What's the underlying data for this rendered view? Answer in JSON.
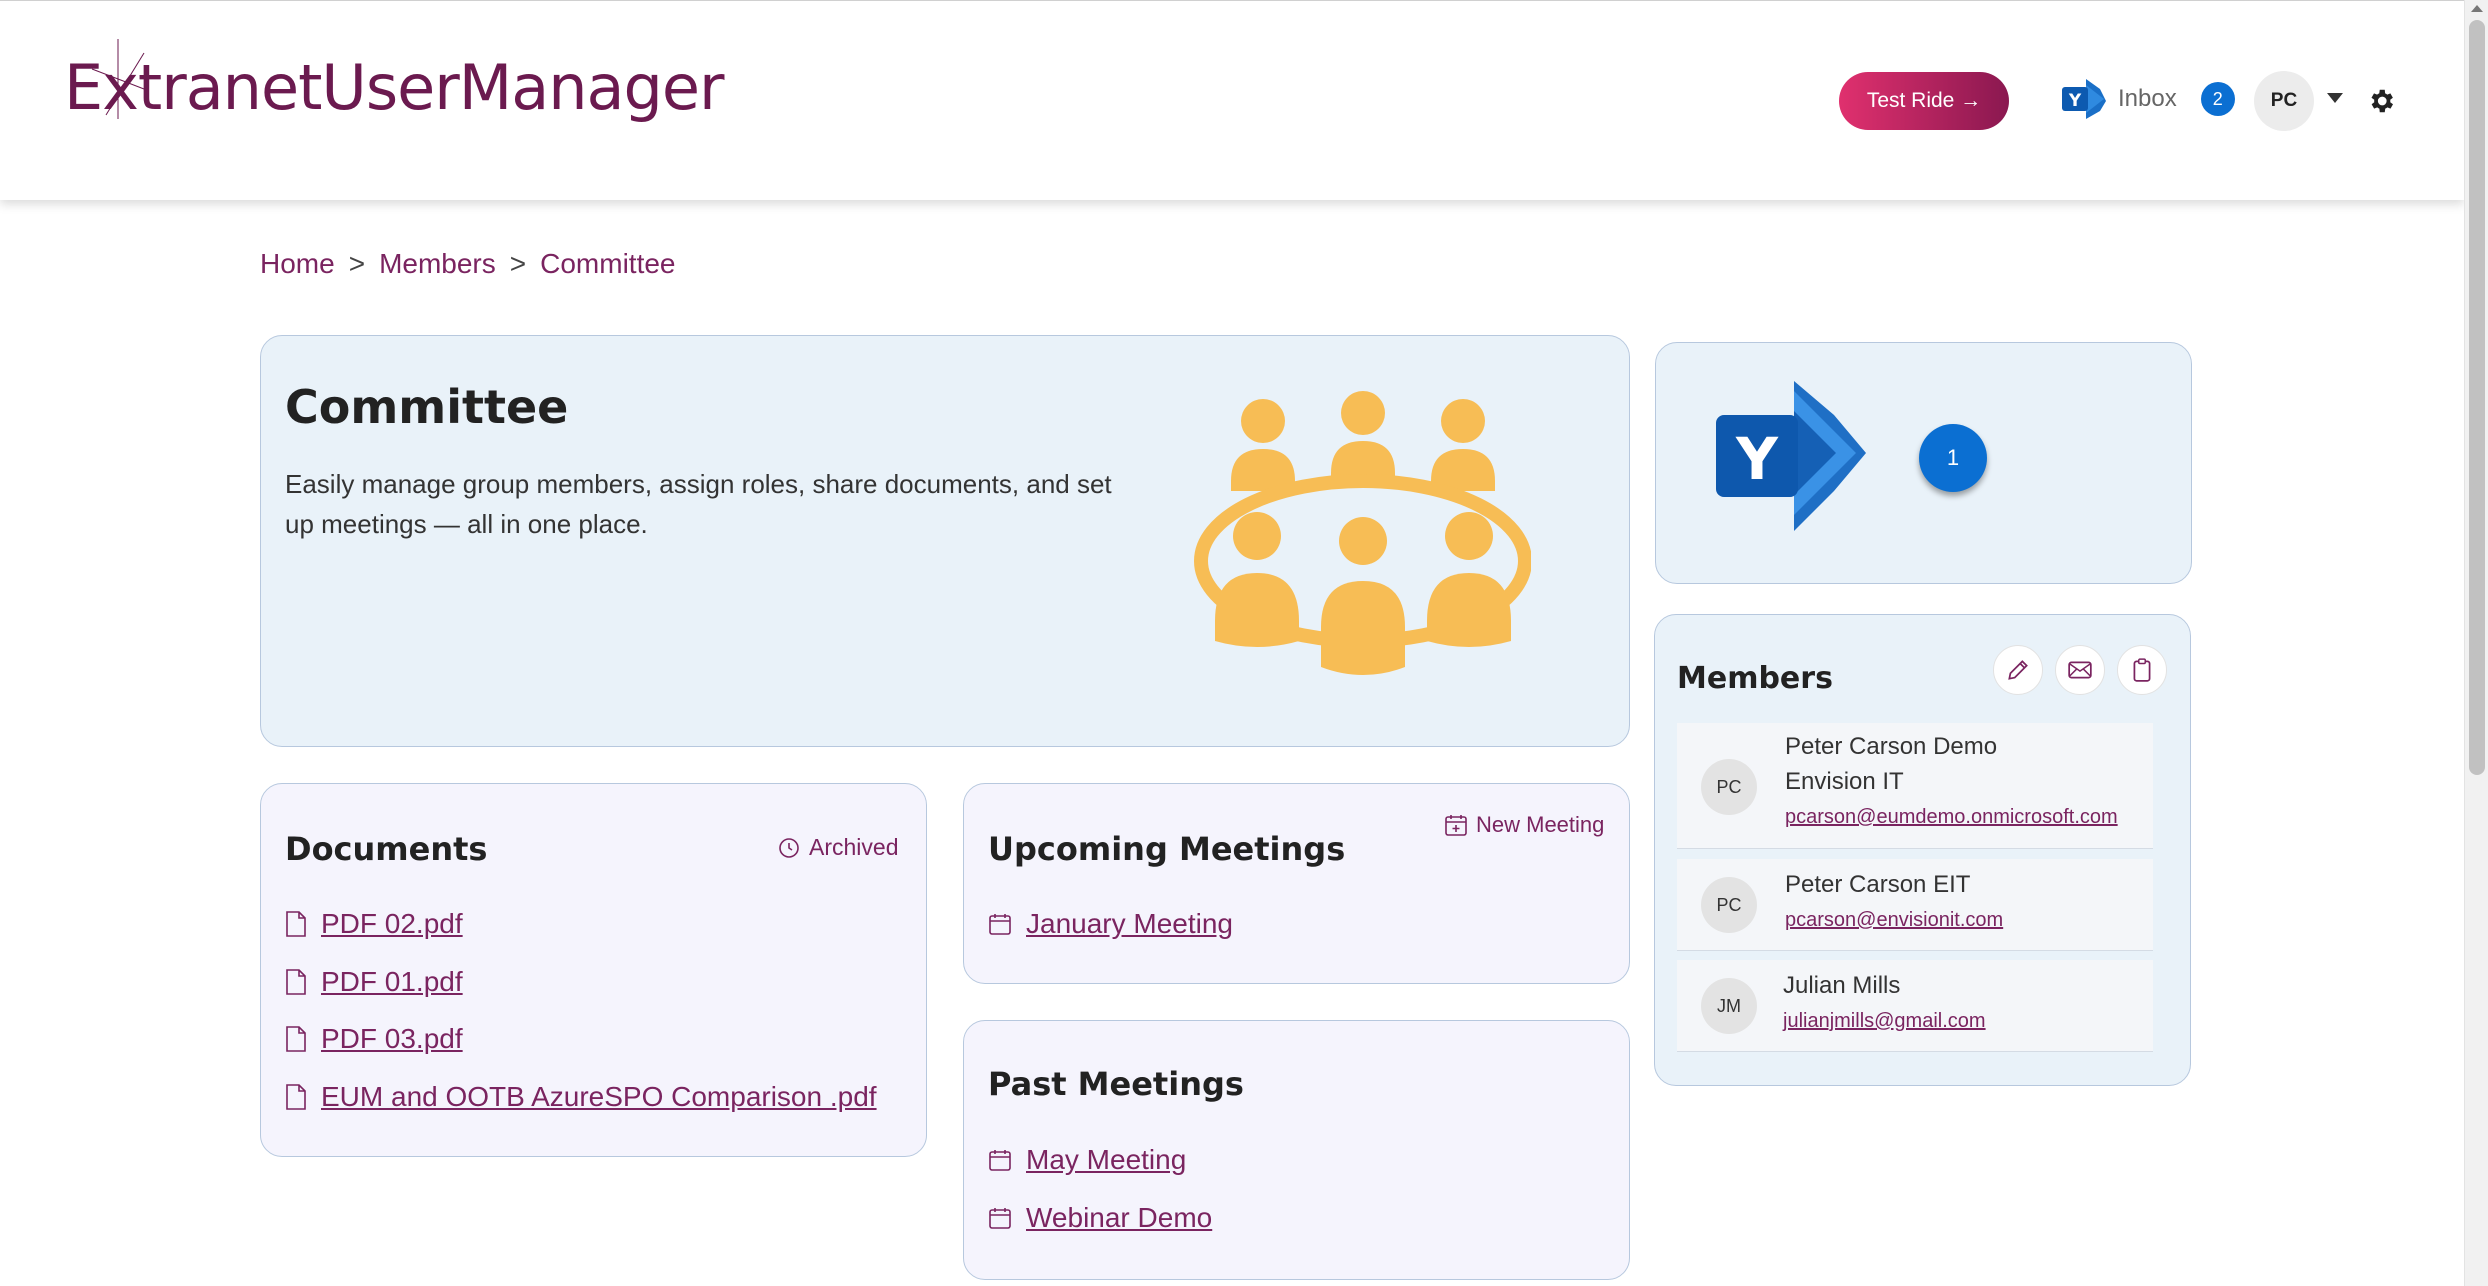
{
  "header": {
    "logo_text": "ExtranetUserManager",
    "logo_first": "E",
    "logo_x": "x",
    "logo_rest": "tranetUserManager",
    "test_ride_label": "Test Ride →",
    "inbox_label": "Inbox",
    "inbox_count": "2",
    "user_initials": "PC",
    "brand_color": "#6b1a4f"
  },
  "breadcrumb": {
    "items": [
      "Home",
      "Members",
      "Committee"
    ],
    "separator": ">"
  },
  "hero": {
    "title": "Committee",
    "description": "Easily manage group members, assign roles, share documents, and set up meetings — all in one place."
  },
  "yammer": {
    "badge_count": "1",
    "icon": "yammer-logo-icon"
  },
  "members": {
    "title": "Members",
    "tools": [
      "pencil-icon",
      "envelope-icon",
      "clipboard-icon"
    ],
    "list": [
      {
        "initials": "PC",
        "name": "Peter Carson Demo",
        "company": "Envision IT",
        "email": "pcarson@eumdemo.onmicrosoft.com"
      },
      {
        "initials": "PC",
        "name": "Peter Carson EIT",
        "company": "",
        "email": "pcarson@envisionit.com"
      },
      {
        "initials": "JM",
        "name": "Julian Mills",
        "company": "",
        "email": "julianjmills@gmail.com"
      }
    ]
  },
  "documents": {
    "title": "Documents",
    "archived_label": "Archived",
    "files": [
      "PDF 02.pdf",
      "PDF 01.pdf",
      "PDF 03.pdf",
      "EUM and OOTB AzureSPO Comparison .pdf"
    ]
  },
  "upcoming": {
    "title": "Upcoming Meetings",
    "new_meeting_label": "New Meeting",
    "meetings": [
      "January Meeting"
    ]
  },
  "past": {
    "title": "Past Meetings",
    "meetings": [
      "May Meeting",
      "Webinar Demo"
    ]
  }
}
